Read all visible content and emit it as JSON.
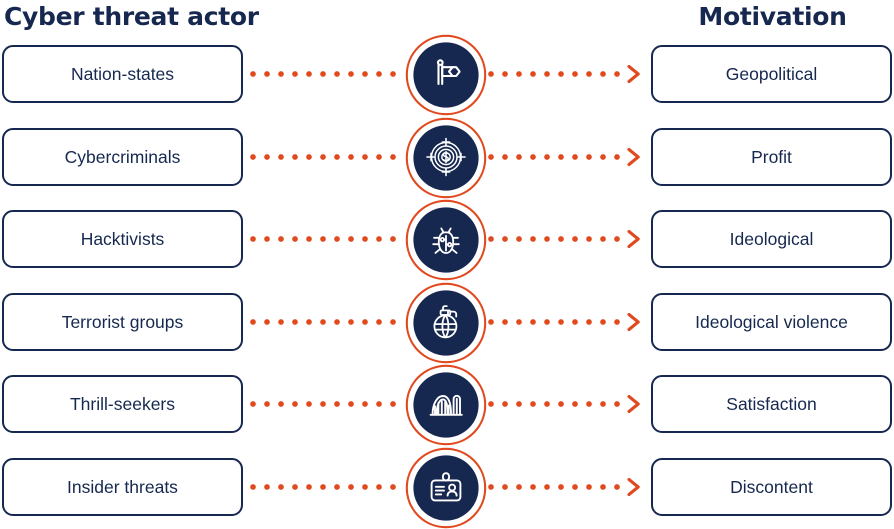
{
  "headers": {
    "left": "Cyber threat actor",
    "right": "Motivation"
  },
  "colors": {
    "navy": "#16284F",
    "orange": "#E1491F",
    "background": "#FFFFFF"
  },
  "rows": [
    {
      "actor": "Nation-states",
      "motivation": "Geopolitical",
      "icon": "flag-icon",
      "connector": "dotted-arrow-right"
    },
    {
      "actor": "Cybercriminals",
      "motivation": "Profit",
      "icon": "money-target-icon",
      "connector": "dotted-arrow-right"
    },
    {
      "actor": "Hacktivists",
      "motivation": "Ideological",
      "icon": "bug-icon",
      "connector": "dotted-arrow-right"
    },
    {
      "actor": "Terrorist groups",
      "motivation": "Ideological violence",
      "icon": "grenade-icon",
      "connector": "dotted-arrow-right"
    },
    {
      "actor": "Thrill-seekers",
      "motivation": "Satisfaction",
      "icon": "roller-coaster-icon",
      "connector": "dotted-arrow-right"
    },
    {
      "actor": "Insider threats",
      "motivation": "Discontent",
      "icon": "id-badge-icon",
      "connector": "dotted-arrow-right"
    }
  ]
}
